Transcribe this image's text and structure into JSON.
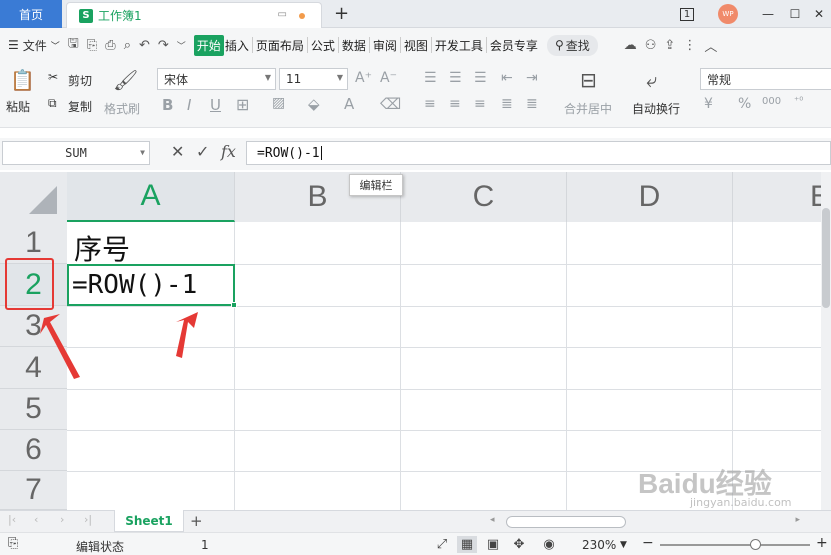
{
  "titlebar": {
    "home_tab": "首页",
    "doc_tab": "工作簿1",
    "doc_icon": "S",
    "new_tab": "+",
    "badge": "1",
    "avatar": "WP"
  },
  "menubar": {
    "file": "文件",
    "tabs": [
      "开始",
      "插入",
      "页面布局",
      "公式",
      "数据",
      "审阅",
      "视图",
      "开发工具",
      "会员专享"
    ],
    "search": "查找"
  },
  "ribbon": {
    "paste": "粘贴",
    "cut": "剪切",
    "copy": "复制",
    "format_painter": "格式刷",
    "font_name": "宋体",
    "font_size": "11",
    "merge_center": "合并居中",
    "wrap_text": "自动换行",
    "number_format": "常规",
    "currency_symbol": "¥",
    "percent_symbol": "%"
  },
  "formula_bar": {
    "name_box": "SUM",
    "fx": "fx",
    "formula": "=ROW()-1",
    "tooltip": "编辑栏"
  },
  "grid": {
    "columns": [
      "A",
      "B",
      "C",
      "D",
      "E"
    ],
    "rows": [
      "1",
      "2",
      "3",
      "4",
      "5",
      "6",
      "7"
    ],
    "cells": {
      "A1": "序号",
      "A2": "=ROW()-1"
    },
    "selected_column": "A",
    "selected_row": "2"
  },
  "sheets": {
    "tabs": [
      "Sheet1"
    ],
    "add": "+"
  },
  "statusbar": {
    "mode": "编辑状态",
    "count": "1",
    "zoom": "230%"
  },
  "watermark": {
    "text": "Baidu经验",
    "url": "jingyan.baidu.com"
  },
  "colors": {
    "accent_green": "#1aa260",
    "home_blue": "#3a7bd5",
    "annotation_red": "#e53935"
  }
}
